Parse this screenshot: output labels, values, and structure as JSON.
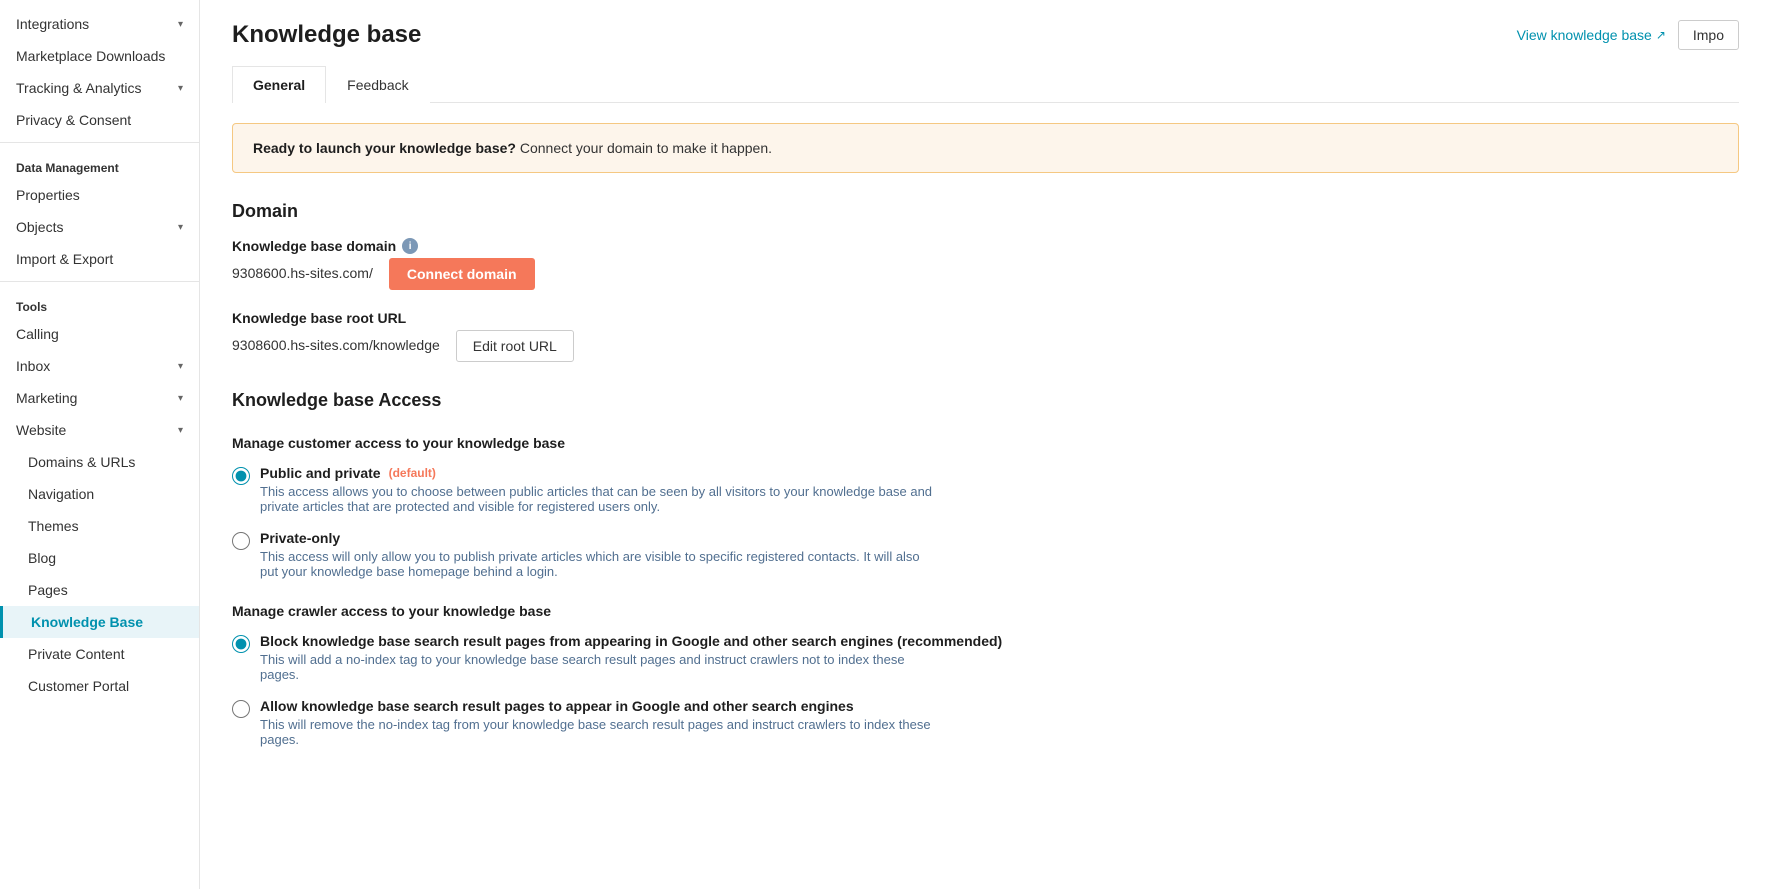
{
  "sidebar": {
    "items": [
      {
        "id": "integrations",
        "label": "Integrations",
        "hasChevron": true,
        "active": false
      },
      {
        "id": "marketplace-downloads",
        "label": "Marketplace Downloads",
        "hasChevron": false,
        "active": false
      },
      {
        "id": "tracking-analytics",
        "label": "Tracking & Analytics",
        "hasChevron": true,
        "active": false
      },
      {
        "id": "privacy-consent",
        "label": "Privacy & Consent",
        "hasChevron": false,
        "active": false
      }
    ],
    "sections": [
      {
        "title": "Data Management",
        "items": [
          {
            "id": "properties",
            "label": "Properties",
            "hasChevron": false,
            "active": false
          },
          {
            "id": "objects",
            "label": "Objects",
            "hasChevron": true,
            "active": false
          },
          {
            "id": "import-export",
            "label": "Import & Export",
            "hasChevron": false,
            "active": false
          }
        ]
      },
      {
        "title": "Tools",
        "items": [
          {
            "id": "calling",
            "label": "Calling",
            "hasChevron": false,
            "active": false
          },
          {
            "id": "inbox",
            "label": "Inbox",
            "hasChevron": true,
            "active": false
          },
          {
            "id": "marketing",
            "label": "Marketing",
            "hasChevron": true,
            "active": false
          },
          {
            "id": "website",
            "label": "Website",
            "hasChevron": true,
            "active": false
          }
        ]
      },
      {
        "title": "",
        "items": [
          {
            "id": "domains-urls",
            "label": "Domains & URLs",
            "hasChevron": false,
            "active": false
          },
          {
            "id": "navigation",
            "label": "Navigation",
            "hasChevron": false,
            "active": false
          },
          {
            "id": "themes",
            "label": "Themes",
            "hasChevron": false,
            "active": false
          },
          {
            "id": "blog",
            "label": "Blog",
            "hasChevron": false,
            "active": false
          },
          {
            "id": "pages",
            "label": "Pages",
            "hasChevron": false,
            "active": false
          },
          {
            "id": "knowledge-base",
            "label": "Knowledge Base",
            "hasChevron": false,
            "active": true
          },
          {
            "id": "private-content",
            "label": "Private Content",
            "hasChevron": false,
            "active": false
          },
          {
            "id": "customer-portal",
            "label": "Customer Portal",
            "hasChevron": false,
            "active": false
          }
        ]
      }
    ]
  },
  "page": {
    "title": "Knowledge base",
    "view_link_label": "View knowledge base",
    "import_button_label": "Impo",
    "tabs": [
      {
        "id": "general",
        "label": "General",
        "active": true
      },
      {
        "id": "feedback",
        "label": "Feedback",
        "active": false
      }
    ],
    "banner": {
      "bold_text": "Ready to launch your knowledge base?",
      "text": "Connect your domain to make it happen."
    },
    "domain_section": {
      "title": "Domain",
      "domain_label": "Knowledge base domain",
      "domain_value": "9308600.hs-sites.com/",
      "connect_button_label": "Connect domain",
      "root_url_label": "Knowledge base root URL",
      "root_url_value": "9308600.hs-sites.com/knowledge",
      "edit_root_url_label": "Edit root URL"
    },
    "access_section": {
      "title": "Knowledge base Access",
      "manage_label": "Manage customer access to your knowledge base",
      "options": [
        {
          "id": "public-private",
          "label": "Public and private",
          "badge": "(default)",
          "description": "This access allows you to choose between public articles that can be seen by all visitors to your knowledge base and private articles that are protected and visible for registered users only.",
          "checked": true
        },
        {
          "id": "private-only",
          "label": "Private-only",
          "badge": "",
          "description": "This access will only allow you to publish private articles which are visible to specific registered contacts. It will also put your knowledge base homepage behind a login.",
          "checked": false
        }
      ],
      "crawler_label": "Manage crawler access to your knowledge base",
      "crawler_options": [
        {
          "id": "block-crawlers",
          "label": "Block knowledge base search result pages from appearing in Google and other search engines (recommended)",
          "description": "This will add a no-index tag to your knowledge base search result pages and instruct crawlers not to index these pages.",
          "checked": true
        },
        {
          "id": "allow-crawlers",
          "label": "Allow knowledge base search result pages to appear in Google and other search engines",
          "description": "This will remove the no-index tag from your knowledge base search result pages and instruct crawlers to index these pages.",
          "checked": false
        }
      ]
    }
  }
}
